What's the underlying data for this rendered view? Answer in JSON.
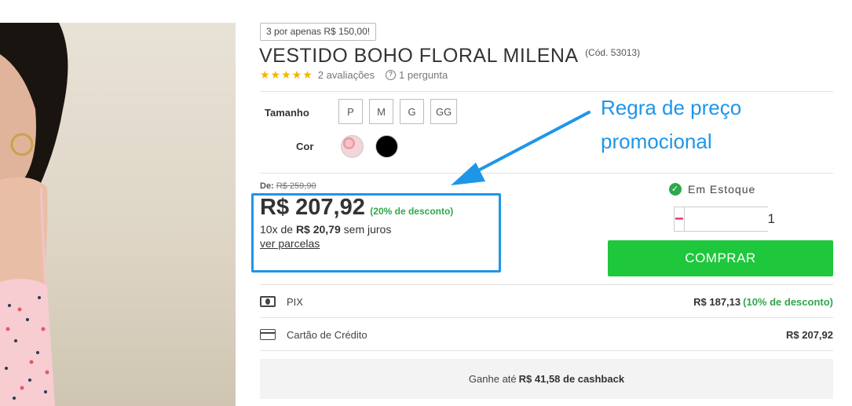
{
  "product": {
    "promo_badge": "3 por apenas R$ 150,00!",
    "title": "VESTIDO BOHO FLORAL MILENA",
    "code": "(Cód. 53013)",
    "stars": "★★★★★",
    "reviews": "2 avaliações",
    "questions": "1 pergunta"
  },
  "options": {
    "size_label": "Tamanho",
    "sizes": [
      "P",
      "M",
      "G",
      "GG"
    ],
    "color_label": "Cor",
    "colors": [
      "floral-rosa",
      "preto"
    ]
  },
  "price": {
    "old_label": "De:",
    "old_value": "R$ 259,90",
    "current": "R$ 207,92",
    "discount": "(20% de desconto)",
    "installments_prefix": "10x de",
    "installments_value": "R$ 20,79",
    "installments_suffix": "sem juros",
    "see_parcels": "ver parcelas"
  },
  "stock": {
    "label": "Em Estoque",
    "quantity": "1",
    "minus": "−",
    "plus": "+"
  },
  "buy_button": "COMPRAR",
  "payment": {
    "pix_label": "PIX",
    "pix_price": "R$ 187,13",
    "pix_discount": "(10% de desconto)",
    "card_label": "Cartão de Crédito",
    "card_price": "R$ 207,92"
  },
  "cashback": {
    "prefix": "Ganhe até",
    "value": "R$ 41,58 de cashback"
  },
  "annotation": {
    "line1": "Regra de preço",
    "line2": "promocional"
  },
  "colors": {
    "accent_blue": "#1e96e8",
    "buy_green": "#1ec73c",
    "discount_green": "#2ea84a",
    "qty_pink": "#e0235c",
    "star_yellow": "#f5b300"
  }
}
